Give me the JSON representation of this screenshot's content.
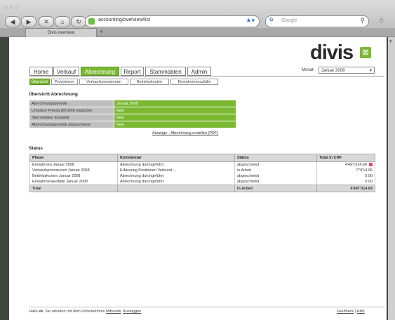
{
  "browser": {
    "window_lights": "○○○",
    "url": "accounting/overview/list",
    "search_placeholder": "Google",
    "search_engine_icon": "G",
    "tab_label": "Divis overview",
    "tab_plus": "+",
    "back_label": "◀",
    "forward_label": "▶",
    "stop_label": "✕",
    "home_label": "⌂",
    "reload_label": "↻",
    "bookmark_label": "★▾",
    "search_mag": "⚲",
    "right_home": "⌂"
  },
  "logo": {
    "text": "divis",
    "mark": "⊠"
  },
  "nav": {
    "items": [
      {
        "label": "Home"
      },
      {
        "label": "Verkauf"
      },
      {
        "label": "Abrechnung"
      },
      {
        "label": "Report"
      },
      {
        "label": "Stammdaten"
      },
      {
        "label": "Admin"
      }
    ],
    "month_label": "Monat:",
    "month_value": "Januar 2008",
    "month_arrow": "▾"
  },
  "subnav": {
    "items": [
      {
        "label": "Übersicht"
      },
      {
        "label": "Provisionen"
      },
      {
        "label": "Verkaufsprovisionen"
      },
      {
        "label": "Betriebskosten"
      },
      {
        "label": "Einnahmenausfälle"
      }
    ]
  },
  "overview": {
    "title": "Übersicht Abrechnung",
    "rows": [
      {
        "key": "Abrechnungsperiode",
        "value": "Januar 2008"
      },
      {
        "key": "Umsätze Prisma (BT100) ergänzen",
        "value": "Nein"
      },
      {
        "key": "Stammdaten komplett",
        "value": "Nein"
      },
      {
        "key": "Abrechnungsperiode abgeschreist",
        "value": "Nein"
      }
    ],
    "pdf_link": "Auszüge - Abrechnung erstellen (PDF)"
  },
  "status": {
    "title": "Status",
    "headers": [
      "Phase",
      "Kommentar",
      "Status",
      "Total in CHF"
    ],
    "rows": [
      {
        "phase": "Einnahmen Januar 2008",
        "comment": "Abrechnung durchgeführt",
        "status": "abgeschreist",
        "total": "4'497'314.00"
      },
      {
        "phase": "Verkaufsprovisionen Januar 2008",
        "comment": "Erfassung Positionen Verbund ...",
        "status": "in Arbeit",
        "total": "779'14.95"
      },
      {
        "phase": "Betriebskosten Januar 2008",
        "comment": "Abrechnung durchgeführt",
        "status": "abgeschreist",
        "total": "0.00"
      },
      {
        "phase": "Einnahmenausfälle Januar 2008",
        "comment": "Abrechnung durchgeführt",
        "status": "abgeschreist",
        "total": "0.00"
      }
    ],
    "total": {
      "label": "Total",
      "comment": "",
      "status": "in Arbeit",
      "value": "4'497'314.69"
    }
  },
  "footer": {
    "prefix": "Hallo",
    "user": "ek",
    "middle": "Sie arbeiten mit dem Unternehmen",
    "company": "Mitreede",
    "logout": "Ausloggen",
    "feedback": "Feedback",
    "sep": "|",
    "help": "Hilfe"
  }
}
